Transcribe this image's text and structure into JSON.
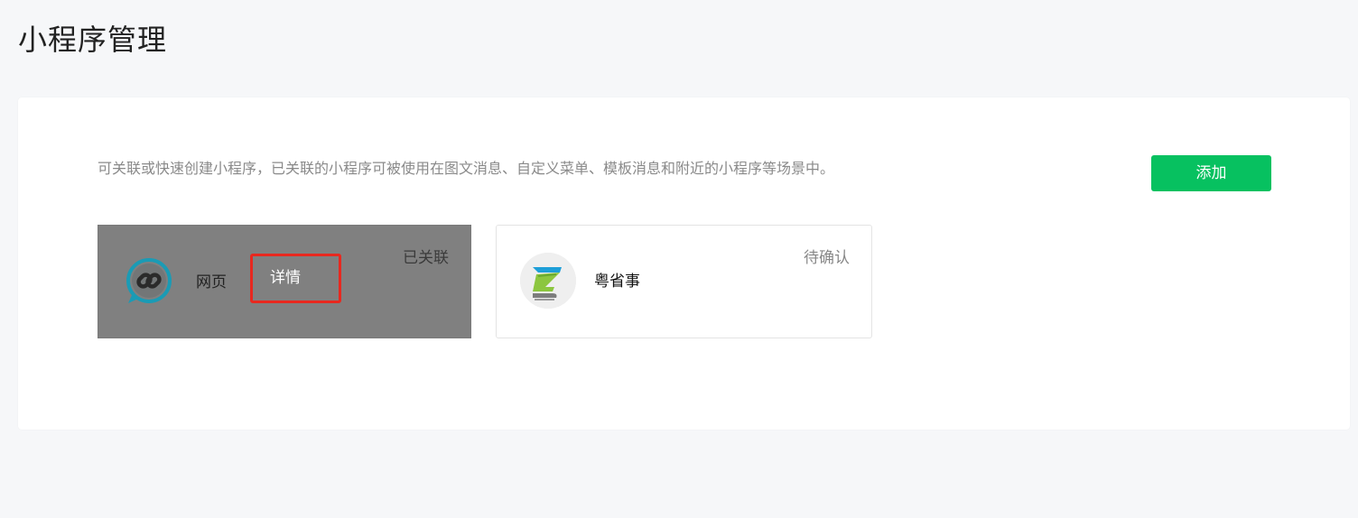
{
  "page": {
    "title": "小程序管理"
  },
  "panel": {
    "description": "可关联或快速创建小程序，已关联的小程序可被使用在图文消息、自定义菜单、模板消息和附近的小程序等场景中。",
    "add_label": "添加"
  },
  "cards": [
    {
      "name": "网页",
      "status": "已关联",
      "detail_label": "详情",
      "icon": "link-icon"
    },
    {
      "name": "粤省事",
      "status": "待确认",
      "icon": "yueshengshi-logo"
    }
  ],
  "colors": {
    "accent": "#07c160",
    "highlight_border": "#e8281f",
    "selected_card": "#808080"
  }
}
